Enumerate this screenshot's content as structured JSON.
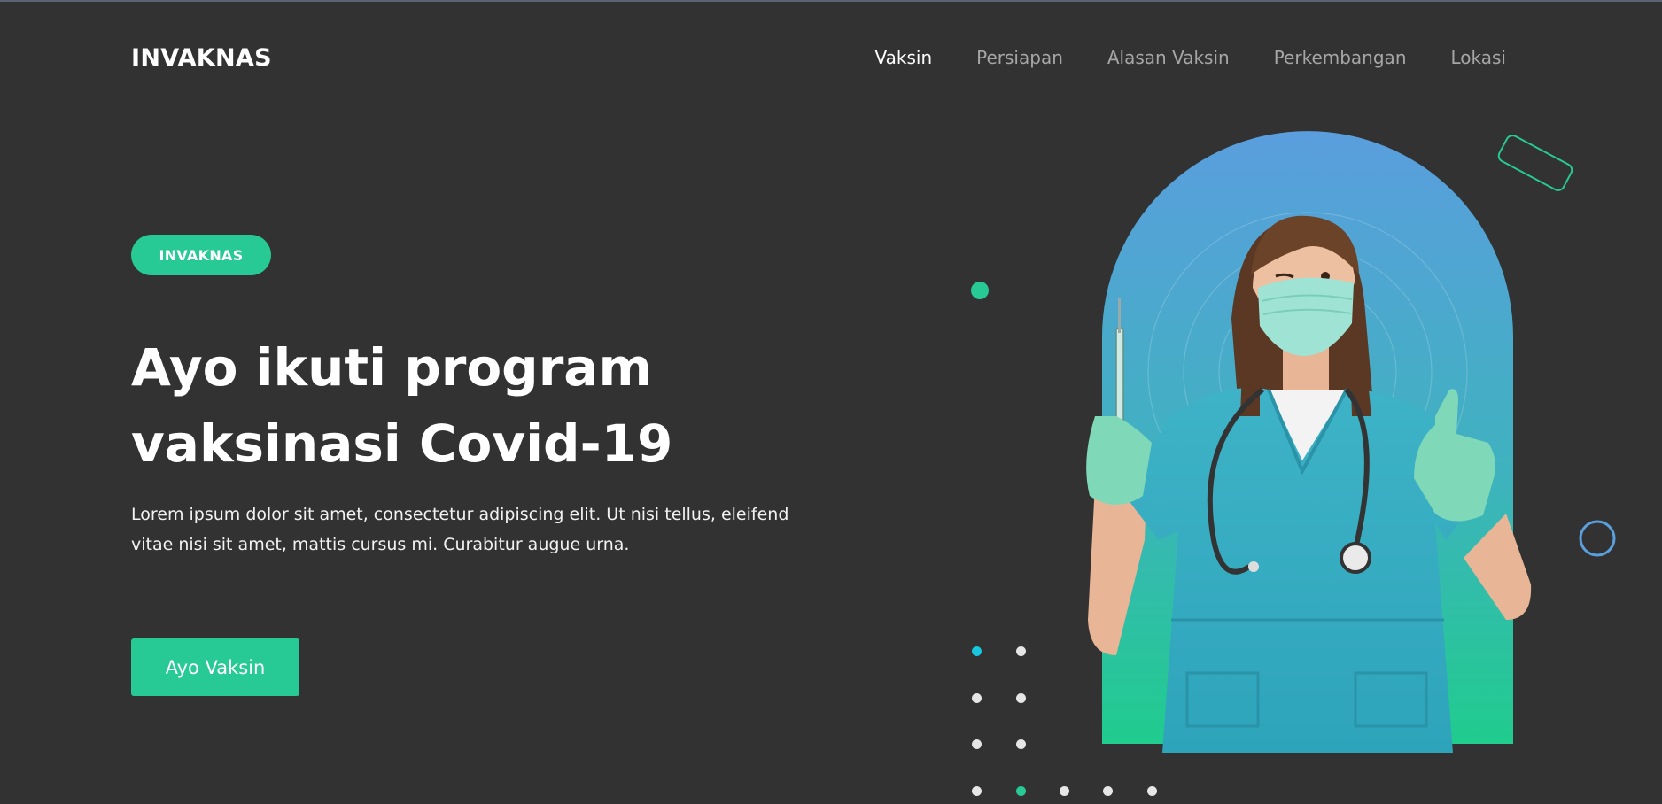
{
  "header": {
    "brand": "INVAKNAS",
    "nav": [
      {
        "label": "Vaksin",
        "active": true
      },
      {
        "label": "Persiapan",
        "active": false
      },
      {
        "label": "Alasan Vaksin",
        "active": false
      },
      {
        "label": "Perkembangan",
        "active": false
      },
      {
        "label": "Lokasi",
        "active": false
      }
    ]
  },
  "hero": {
    "badge": "INVAKNAS",
    "headline_lines": [
      "Ayo ikuti program",
      "vaksinasi Covid-19"
    ],
    "description_lines": [
      "Lorem ipsum dolor sit amet, consectetur adipiscing elit. Ut nisi tellus, eleifend",
      "vitae nisi sit amet, mattis cursus mi. Curabitur augue urna."
    ],
    "cta_label": "Ayo Vaksin"
  },
  "colors": {
    "background": "#323232",
    "accent_green": "#27c994",
    "accent_blue": "#5ba0de",
    "accent_cyan": "#18c6e0",
    "nav_inactive": "#a6a6a6"
  },
  "icons": {
    "nurse_image": "nurse-holding-syringe-thumbs-up",
    "shapes": [
      "rounded-rectangle-outline",
      "circle-outline",
      "dot-grid"
    ]
  }
}
